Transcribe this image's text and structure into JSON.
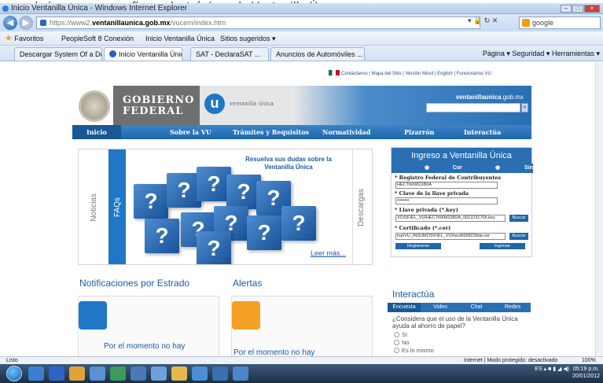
{
  "caption": "...sado ingresa con su firma electrónica a la Ventanilla Ún...",
  "window": {
    "title": "Inicio Ventanilla Única - Windows Internet Explorer"
  },
  "address": {
    "prefix": "https://www2.",
    "domain": "ventanillaunica.gob.mx",
    "path": "/vucem/index.htm",
    "search_placeholder": "google"
  },
  "favorites": {
    "label": "Favoritos",
    "items": [
      "PeopleSoft 8 Conexión",
      "Inicio Ventanilla Única",
      "Sitios sugeridos ▾"
    ]
  },
  "tabs": [
    "Descargar System Of a Do...",
    "Inicio Ventanilla Única",
    "SAT - DeclaraSAT ...",
    "Anuncios de Automóviles ..."
  ],
  "commands": "Página ▾  Seguridad ▾  Herramientas ▾",
  "site": {
    "toplinks": "Contáctanos | Mapa del Sitio | Versión Móvil | English | Funcionarios VU",
    "gobierno": "GOBIERNO FEDERAL",
    "vu_text": "ventanilla única",
    "domain_bold": "ventanillaunica",
    "domain_rest": ".gob.mx",
    "menu": [
      "Inicio",
      "Sobre la VU",
      "Trámites y Requisitos",
      "Normatividad",
      "Pizarrón",
      "Interactúa"
    ],
    "promo": {
      "left_tab": "Noticias",
      "mid_tab": "FAQs",
      "right_tab": "Descargas",
      "headline": "Resuelva sus dudas sobre la Ventanilla Única",
      "more": "Leer más..."
    },
    "login": {
      "title": "Ingreso a Ventanilla Única",
      "tab_fiel": "Con FIEL",
      "tab_sinfiel": "Sin FIEL",
      "rfc_label": "* Registro Federal de Contribuyentes",
      "rfc_value": "HECT6008228DA",
      "clave_label": "* Clave de la llave privada",
      "clave_value": "••••••••",
      "key_label": "* Llave privada (*.key)",
      "key_value": "XOS\\FIEL_VU\\HECT6008228DA_0012231705.key",
      "cer_label": "* Certificado (*.cer)",
      "cer_value": "top\\VU_INSUMOS\\FIEL_VU\\hect6008228da.cer",
      "buscar": "Buscar",
      "registrarse": "Registrarse",
      "ingresar": "Ingresar"
    },
    "notif_title": "Notificaciones por Estrado",
    "notif_body": "Por el momento no hay",
    "alertas_title": "Alertas",
    "alertas_body": "Por el momento no hay",
    "interactua": {
      "title": "Interactúa",
      "tabs": [
        "Encuesta",
        "Video",
        "Chat",
        "Redes"
      ],
      "question": "¿Considera que el uso de la Ventanilla Única ayuda al ahorro de papel?",
      "options": [
        "Sí",
        "No",
        "Es lo mismo"
      ]
    }
  },
  "status": {
    "left": "Listo",
    "middle": "Internet | Modo protegido: desactivado",
    "zoom": "100%"
  },
  "tray": {
    "lang": "ES",
    "time": "05:19 p.m.",
    "date": "20/01/2012"
  },
  "colors": {
    "primary": "#1f66ad",
    "accent": "#2a6eb3"
  }
}
